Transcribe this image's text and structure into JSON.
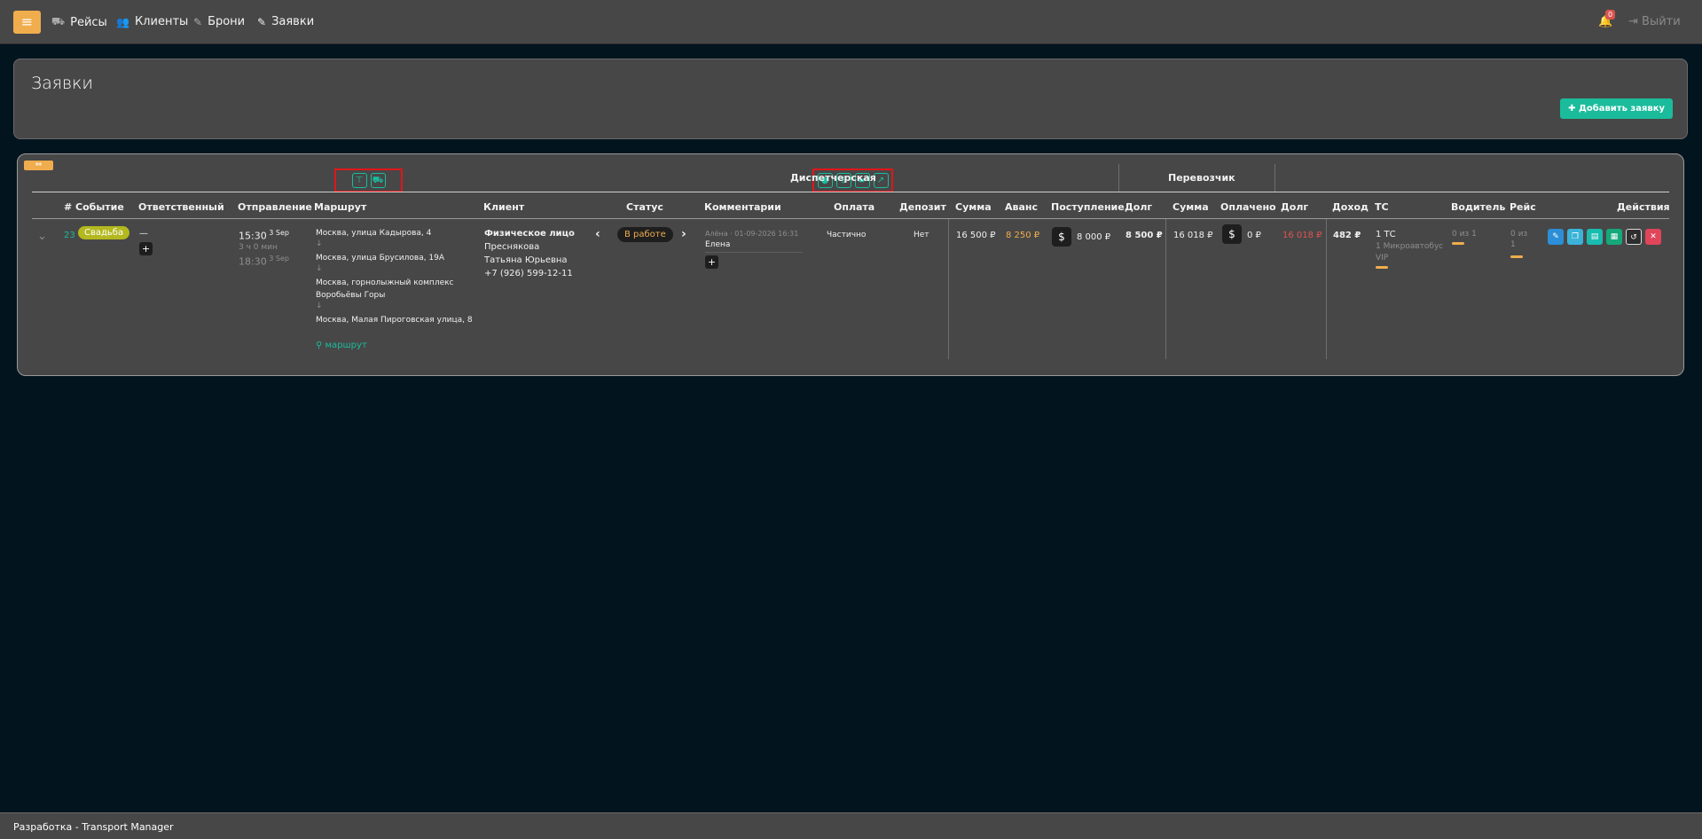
{
  "nav": {
    "menu_icon": "hamburger-icon",
    "items": [
      {
        "label": "Рейсы",
        "icon": "car-icon"
      },
      {
        "label": "Клиенты",
        "icon": "users-icon"
      },
      {
        "label": "Брони",
        "icon": "edit-icon"
      },
      {
        "label": "Заявки",
        "icon": "edit-icon"
      }
    ],
    "notifications_count": "0",
    "logout_label": "Выйти"
  },
  "page": {
    "title": "Заявки",
    "add_button": "Добавить заявку"
  },
  "table": {
    "group_headers": {
      "dispatch": "Диспетчерская",
      "carrier": "Перевозчик"
    },
    "headers": {
      "event": "# Событие",
      "responsible": "Ответственный",
      "departure": "Отправление",
      "route": "Маршрут",
      "client": "Клиент",
      "status": "Статус",
      "comments": "Комментарии",
      "payment": "Оплата",
      "deposit": "Депозит",
      "d_sum": "Сумма",
      "d_advance": "Аванс",
      "d_income": "Поступление",
      "d_debt": "Долг",
      "c_sum": "Сумма",
      "c_paid": "Оплачено",
      "c_debt": "Долг",
      "profit": "Доход",
      "vehicle": "ТС",
      "driver": "Водитель",
      "trip": "Рейс",
      "actions": "Действия"
    },
    "row": {
      "id": "23",
      "event": "Свадьба",
      "responsible": "—",
      "departure_time": "15:30",
      "departure_date": "3 Sep",
      "duration": "3 ч 0 мин",
      "arrival_time": "18:30",
      "arrival_date": "3 Sep",
      "route": [
        "Москва, улица Кадырова, 4",
        "Москва, улица Брусилова, 19А",
        "Москва, горнолыжный комплекс",
        "Воробьёвы Горы",
        "Москва, Малая Пироговская улица, 8"
      ],
      "route_arrow": "↓",
      "route_link": "маршрут",
      "client_type": "Физическое лицо",
      "client_lastname": "Преснякова",
      "client_name": "Татьяна Юрьевна",
      "client_phone": "+7 (926) 599-12-11",
      "status": "В работе",
      "comment_meta": "Алёна · 01-09-2026 16:31",
      "comment_text": "Елена",
      "payment": "Частично",
      "deposit": "Нет",
      "d_sum": "16 500 ₽",
      "d_advance": "8 250 ₽",
      "d_income": "8 000 ₽",
      "d_debt": "8 500 ₽",
      "c_sum": "16 018 ₽",
      "c_paid": "0 ₽",
      "c_debt": "16 018 ₽",
      "profit": "482 ₽",
      "vehicle_count": "1 ТС",
      "vehicle_type": "1 Микроавтобус",
      "vehicle_class": "VIP",
      "driver": "0 из 1",
      "trip_line1": "0 из",
      "trip_line2": "1"
    }
  },
  "footer": {
    "text": "Разработка - Transport Manager"
  }
}
